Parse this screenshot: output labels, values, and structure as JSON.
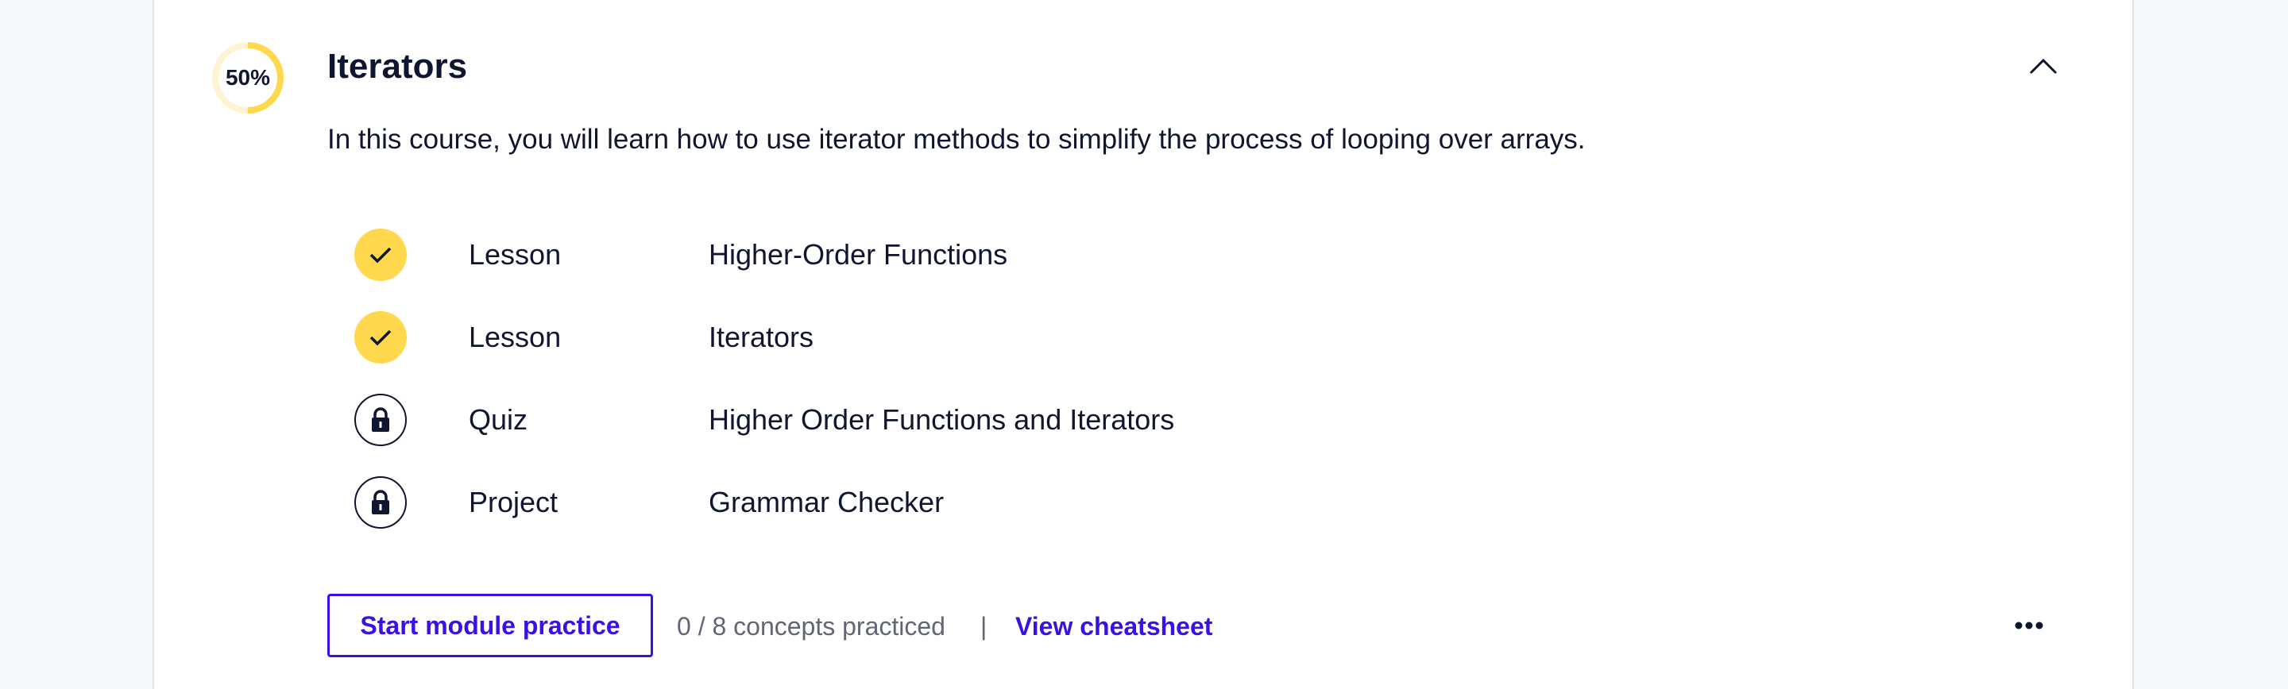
{
  "module": {
    "progress_label": "50%",
    "progress_fraction": 0.5,
    "title": "Iterators",
    "description": "In this course, you will learn how to use iterator methods to simplify the process of looping over arrays."
  },
  "items": [
    {
      "type": "Lesson",
      "name": "Higher-Order Functions",
      "status": "completed",
      "icon": "check-icon"
    },
    {
      "type": "Lesson",
      "name": "Iterators",
      "status": "completed",
      "icon": "check-icon"
    },
    {
      "type": "Quiz",
      "name": "Higher Order Functions and Iterators",
      "status": "locked",
      "icon": "lock-icon"
    },
    {
      "type": "Project",
      "name": "Grammar Checker",
      "status": "locked",
      "icon": "lock-icon"
    }
  ],
  "footer": {
    "practice_button": "Start module practice",
    "concepts_text": "0 / 8 concepts practiced",
    "divider": "|",
    "cheatsheet_link": "View cheatsheet",
    "more_icon": "ellipsis-icon"
  },
  "colors": {
    "accent": "#3a10e5",
    "completed": "#ffd84d",
    "progress_track": "#fff4d1",
    "text": "#10162f",
    "muted": "#626573"
  }
}
